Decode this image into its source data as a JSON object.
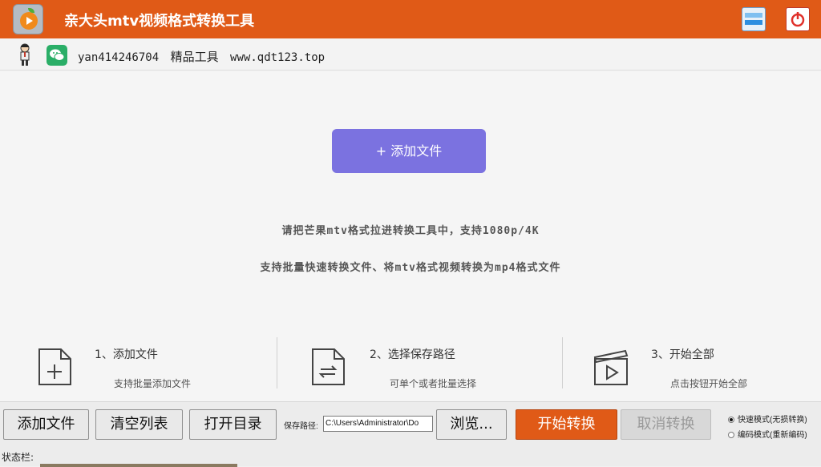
{
  "window": {
    "title": "亲大头mtv视频格式转换工具",
    "icons": [
      "app-logo-icon",
      "minimize-icon",
      "power-close-icon"
    ]
  },
  "info": {
    "account": "yan414246704",
    "tagline": "精品工具",
    "website": "www.qdt123.top"
  },
  "main": {
    "add_button_label": "+ 添加文件",
    "hint_line1": "请把芒果mtv格式拉进转换工具中，支持1080p/4K",
    "hint_line2": "支持批量快速转换文件、将mtv格式视频转换为mp4格式文件"
  },
  "steps": [
    {
      "title": "1、添加文件",
      "subtitle": "支持批量添加文件",
      "icon": "add-file-icon"
    },
    {
      "title": "2、选择保存路径",
      "subtitle": "可单个或者批量选择",
      "icon": "convert-file-icon"
    },
    {
      "title": "3、开始全部",
      "subtitle": "点击按钮开始全部",
      "icon": "clapper-play-icon"
    }
  ],
  "toolbar": {
    "add_label": "添加文件",
    "clear_label": "清空列表",
    "open_dir_label": "打开目录",
    "save_path_label": "保存路径:",
    "save_path_value": "C:\\Users\\Administrator\\Do",
    "browse_label": "浏览...",
    "start_label": "开始转换",
    "cancel_label": "取消转换",
    "mode_fast": "快速模式(无损转换)",
    "mode_encode": "编码模式(重新编码)",
    "selected_mode": "fast"
  },
  "status": {
    "label": "状态栏:"
  },
  "colors": {
    "accent": "#e05a17",
    "add_button": "#7b72e0",
    "wechat": "#2aae67"
  }
}
